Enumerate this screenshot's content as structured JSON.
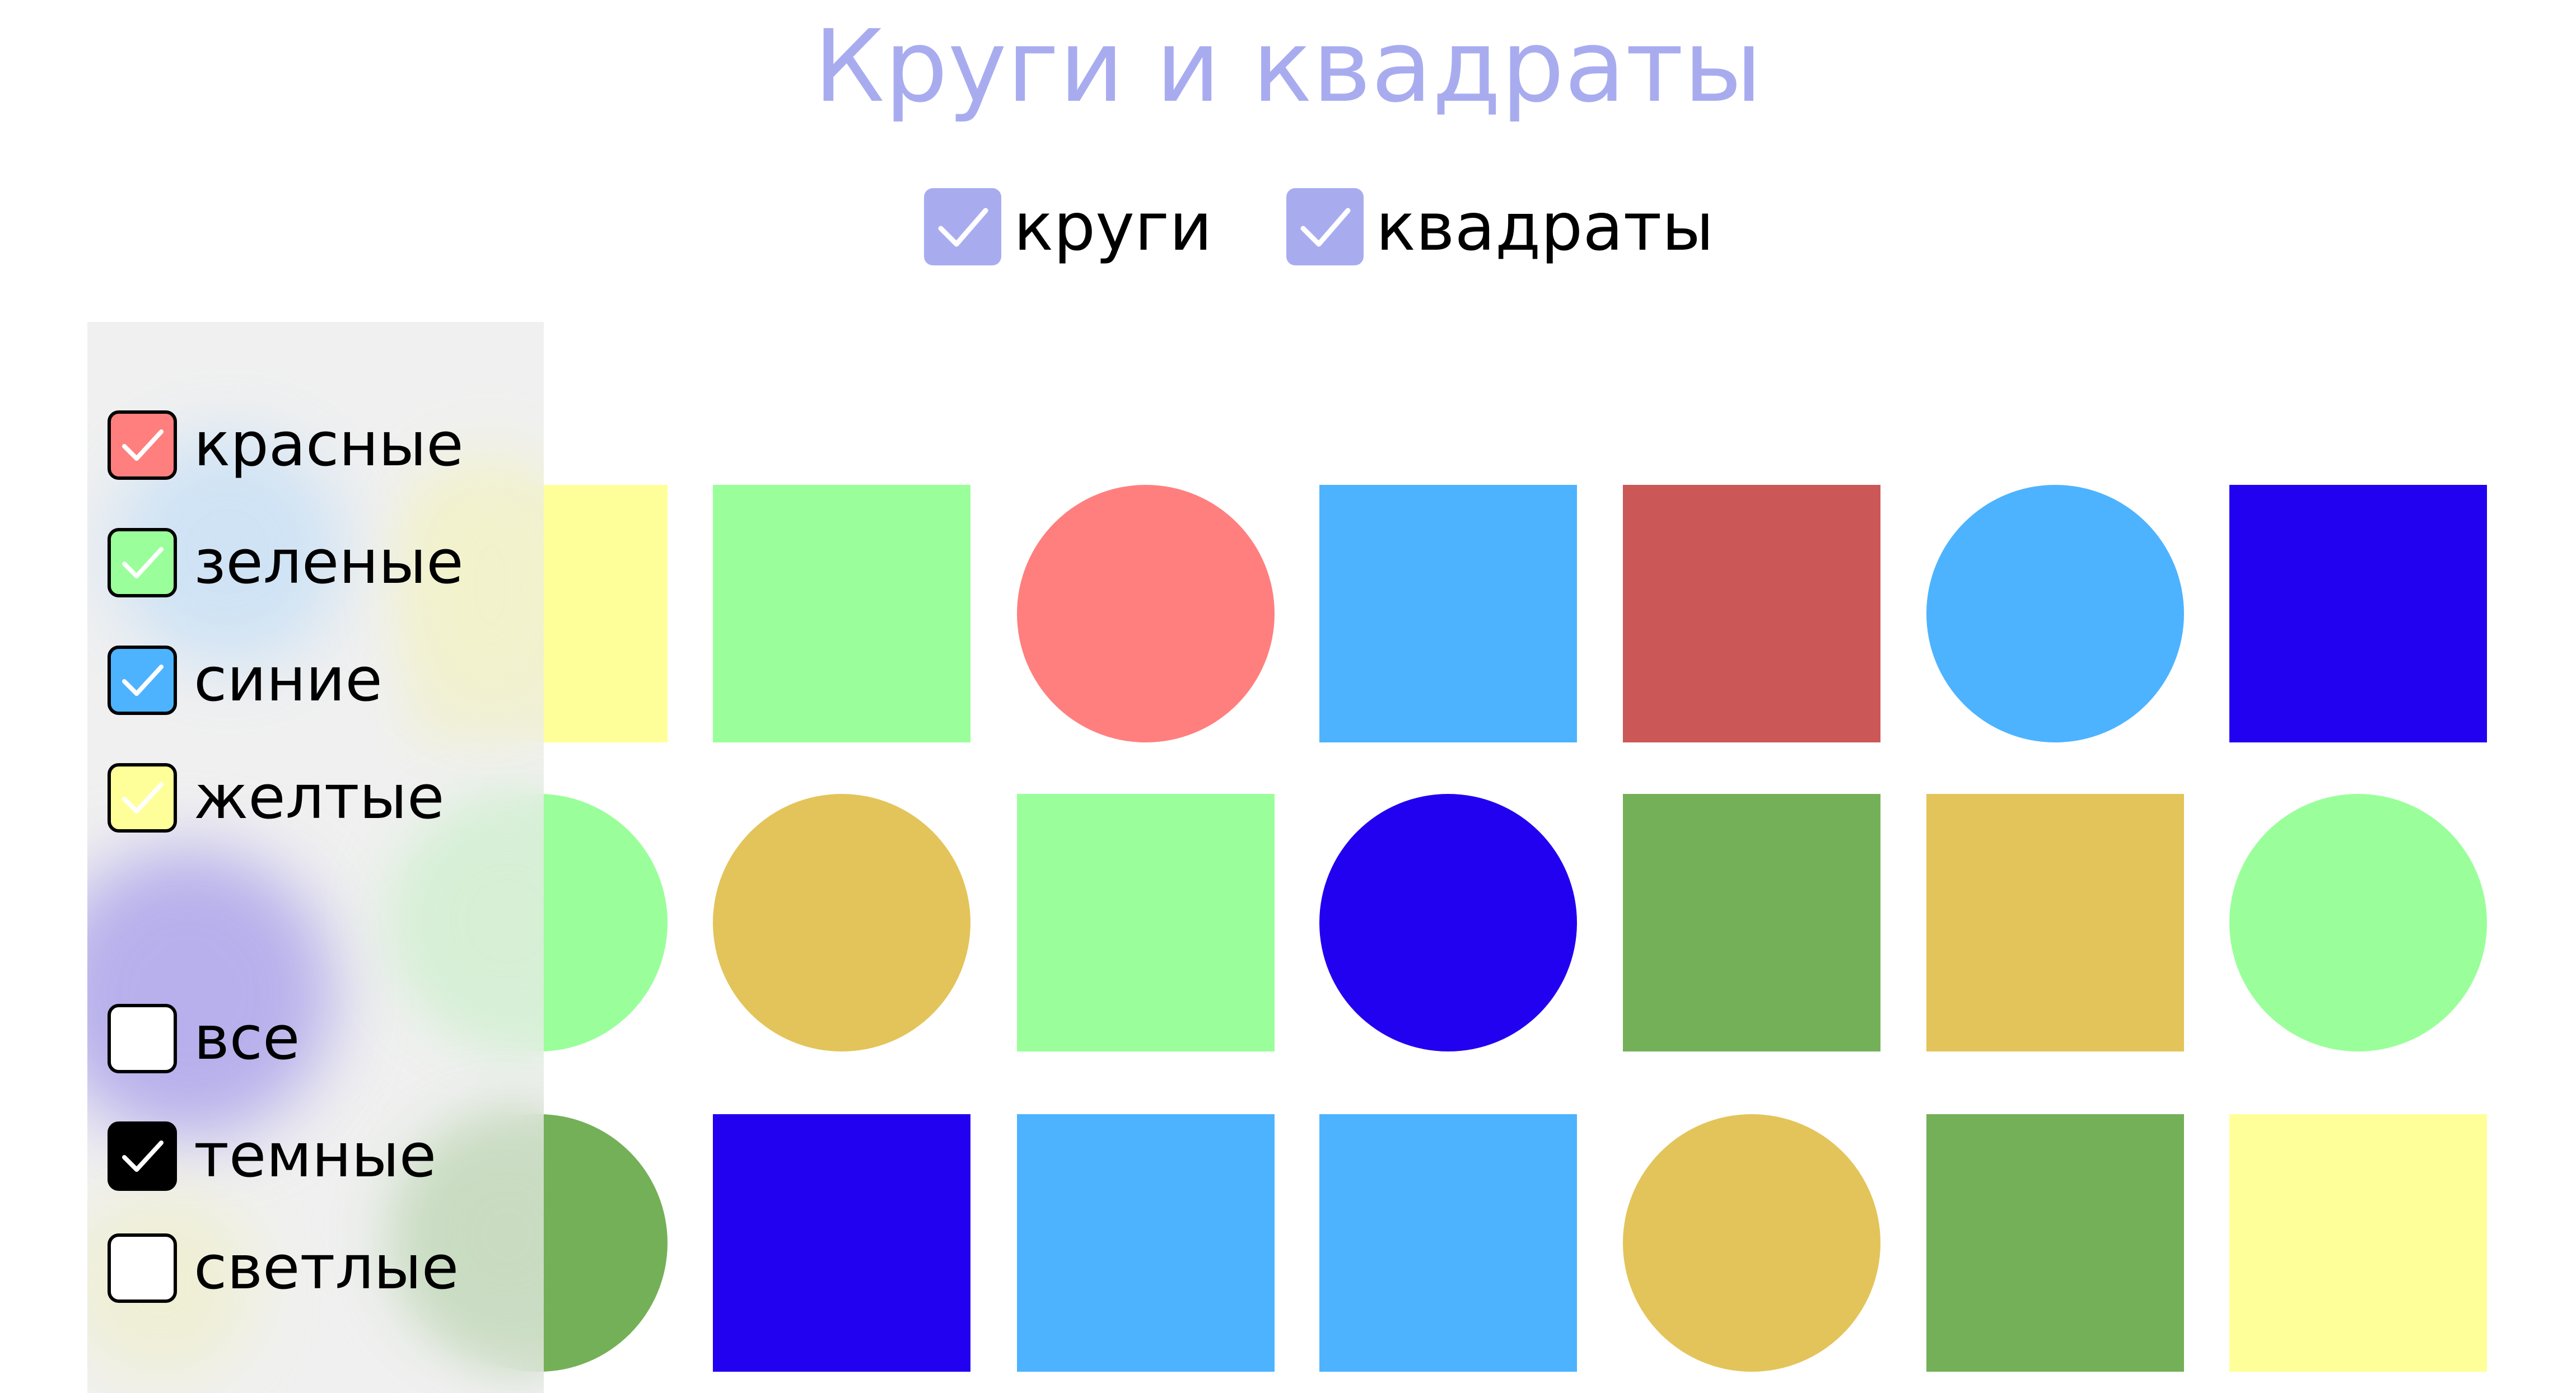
{
  "title": "Круги и квадраты",
  "top_filters": {
    "circles": {
      "label": "круги",
      "checked": true
    },
    "squares": {
      "label": "квадраты",
      "checked": true
    },
    "check_color": "#a8acef"
  },
  "sidebar": {
    "colors": [
      {
        "label": "красные",
        "checked": true,
        "fill": "#ff7f7f"
      },
      {
        "label": "зеленые",
        "checked": true,
        "fill": "#9aff9a"
      },
      {
        "label": "синие",
        "checked": true,
        "fill": "#4db3ff"
      },
      {
        "label": "желтые",
        "checked": true,
        "fill": "#ffff99"
      }
    ],
    "shades": [
      {
        "label": "все",
        "checked": false,
        "fill": "#ffffff"
      },
      {
        "label": "темные",
        "checked": true,
        "fill": "#000000"
      },
      {
        "label": "светлые",
        "checked": false,
        "fill": "#ffffff"
      }
    ]
  },
  "grid": {
    "rows": [
      [
        {
          "shape": "square",
          "color": "#ffff99"
        },
        {
          "shape": "square",
          "color": "#9aff9a"
        },
        {
          "shape": "circle",
          "color": "#ff7f7f"
        },
        {
          "shape": "square",
          "color": "#4db3ff"
        },
        {
          "shape": "square",
          "color": "#cc5757"
        },
        {
          "shape": "circle",
          "color": "#4db3ff"
        },
        {
          "shape": "square",
          "color": "#2200f0"
        }
      ],
      [
        {
          "shape": "circle",
          "color": "#9aff9a"
        },
        {
          "shape": "circle",
          "color": "#e3c45a"
        },
        {
          "shape": "square",
          "color": "#9aff9a"
        },
        {
          "shape": "circle",
          "color": "#2200f0"
        },
        {
          "shape": "square",
          "color": "#74b057"
        },
        {
          "shape": "square",
          "color": "#e3c45a"
        },
        {
          "shape": "circle",
          "color": "#9aff9a"
        }
      ],
      [
        {
          "shape": "circle",
          "color": "#74b057"
        },
        {
          "shape": "square",
          "color": "#2200f0"
        },
        {
          "shape": "square",
          "color": "#4db3ff"
        },
        {
          "shape": "square",
          "color": "#4db3ff"
        },
        {
          "shape": "circle",
          "color": "#e3c45a"
        },
        {
          "shape": "square",
          "color": "#74b057"
        },
        {
          "shape": "square",
          "color": "#ffff99"
        }
      ]
    ]
  }
}
